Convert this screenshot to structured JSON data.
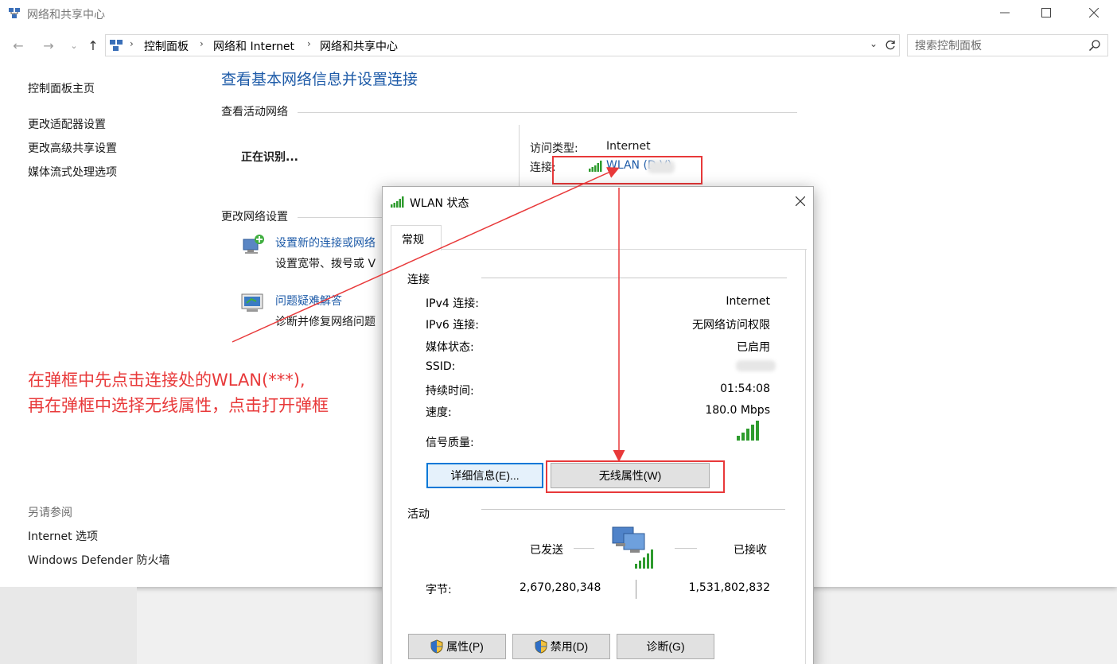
{
  "window": {
    "title": "网络和共享中心"
  },
  "address": {
    "crumbs": [
      "控制面板",
      "网络和 Internet",
      "网络和共享中心"
    ],
    "search_placeholder": "搜索控制面板"
  },
  "sidebar": {
    "home": "控制面板主页",
    "links": [
      "更改适配器设置",
      "更改高级共享设置",
      "媒体流式处理选项"
    ],
    "see_also": "另请参阅",
    "see_also_links": [
      "Internet 选项",
      "Windows Defender 防火墙"
    ]
  },
  "main": {
    "heading": "查看基本网络信息并设置连接",
    "active_networks_label": "查看活动网络",
    "network_name": "正在识别...",
    "access_type_label": "访问类型:",
    "access_type_value": "Internet",
    "connections_label": "连接:",
    "connection_link": "WLAN (D   V)",
    "change_settings_label": "更改网络设置",
    "tasks": [
      {
        "link": "设置新的连接或网络",
        "desc": "设置宽带、拨号或 V"
      },
      {
        "link": "问题疑难解答",
        "desc": "诊断并修复网络问题"
      }
    ]
  },
  "dialog": {
    "title": "WLAN 状态",
    "tab": "常规",
    "connection_group": "连接",
    "rows": [
      {
        "label": "IPv4 连接:",
        "value": "Internet"
      },
      {
        "label": "IPv6 连接:",
        "value": "无网络访问权限"
      },
      {
        "label": "媒体状态:",
        "value": "已启用"
      },
      {
        "label": "SSID:",
        "value": ""
      },
      {
        "label": "持续时间:",
        "value": "01:54:08"
      },
      {
        "label": "速度:",
        "value": "180.0 Mbps"
      }
    ],
    "signal_label": "信号质量:",
    "signal_bars": 5,
    "details_button": "详细信息(E)...",
    "wireless_props_button": "无线属性(W)",
    "activity_group": "活动",
    "sent_label": "已发送",
    "received_label": "已接收",
    "bytes_label": "字节:",
    "bytes_sent": "2,670,280,348",
    "bytes_received": "1,531,802,832",
    "properties_button": "属性(P)",
    "disable_button": "禁用(D)",
    "diagnose_button": "诊断(G)"
  },
  "annotation": {
    "line1": "在弹框中先点击连接处的WLAN(***),",
    "line2": "再在弹框中选择无线属性，点击打开弹框",
    "color": "#e8393a"
  },
  "colors": {
    "link": "#1e5ba8",
    "annotation_red": "#e8393a",
    "signal_green": "#2e9b2e"
  }
}
